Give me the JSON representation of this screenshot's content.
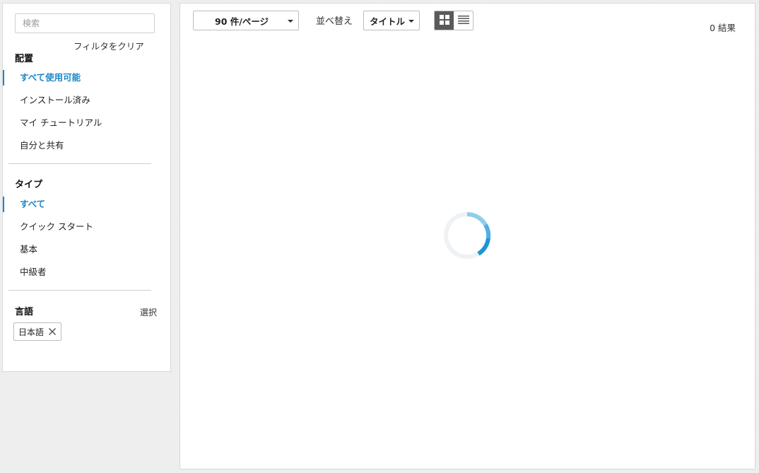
{
  "sidebar": {
    "search_placeholder": "検索",
    "clear_filters": "フィルタをクリア",
    "deployment": {
      "title": "配置",
      "items": [
        {
          "label": "すべて使用可能",
          "active": true
        },
        {
          "label": "インストール済み",
          "active": false
        },
        {
          "label": "マイ チュートリアル",
          "active": false
        },
        {
          "label": "自分と共有",
          "active": false
        }
      ]
    },
    "type": {
      "title": "タイプ",
      "items": [
        {
          "label": "すべて",
          "active": true
        },
        {
          "label": "クイック スタート",
          "active": false
        },
        {
          "label": "基本",
          "active": false
        },
        {
          "label": "中級者",
          "active": false
        }
      ]
    },
    "language": {
      "title": "言語",
      "select_label": "選択",
      "chips": [
        "日本語"
      ]
    }
  },
  "toolbar": {
    "per_page": "90 件/ページ",
    "sort_label": "並べ替え",
    "sort_value": "タイトル",
    "view_mode": "grid",
    "results": "0 結果"
  },
  "colors": {
    "accent": "#1a86c8",
    "spinner": "#2a9ed8"
  },
  "icons": {
    "grid_view": "grid-icon",
    "list_view": "list-icon",
    "chip_remove": "close-icon",
    "loading": "spinner-icon"
  }
}
